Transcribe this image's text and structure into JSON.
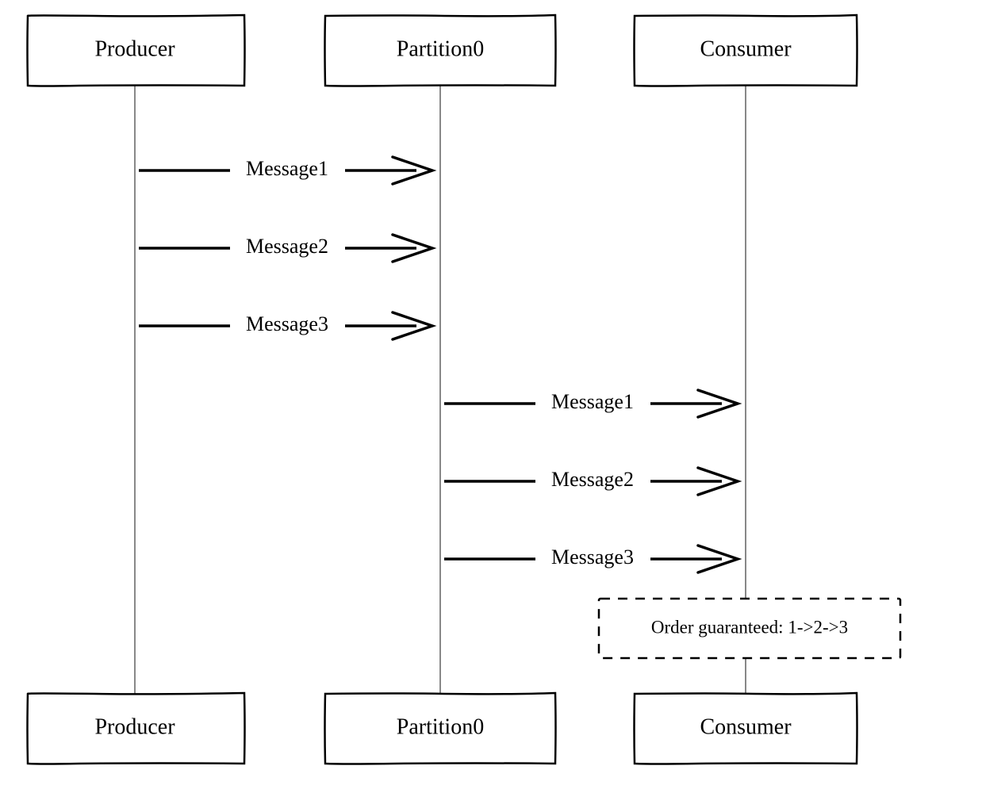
{
  "actors": {
    "producer": "Producer",
    "partition": "Partition0",
    "consumer": "Consumer"
  },
  "messages": {
    "m1": "Message1",
    "m2": "Message2",
    "m3": "Message3",
    "m4": "Message1",
    "m5": "Message2",
    "m6": "Message3"
  },
  "note": "Order guaranteed: 1->2->3"
}
